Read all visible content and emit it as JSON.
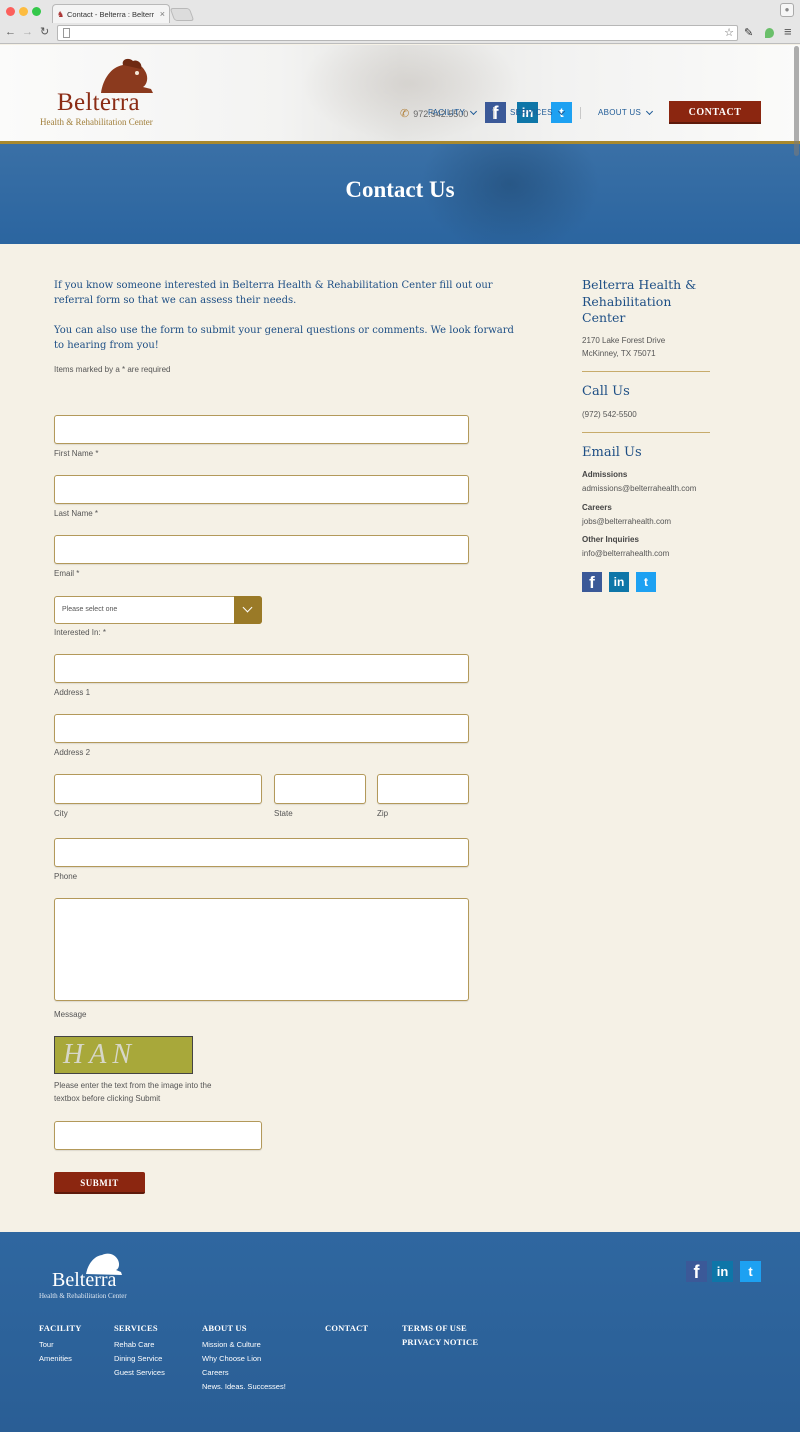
{
  "browser": {
    "tab_title": "Contact - Belterra : Belterr",
    "tab_close": "×",
    "back": "←",
    "forward": "→",
    "reload": "↻",
    "star": "☆",
    "menu": "≡"
  },
  "header": {
    "logo_word": "Belterra",
    "logo_sub": "Health & Rehabilitation Center",
    "phone": "972.542.5500",
    "social": {
      "facebook": "f",
      "linkedin": "in",
      "twitter": "t"
    },
    "nav": [
      {
        "label": "FACILITY"
      },
      {
        "label": "SERVICES"
      },
      {
        "label": "ABOUT US"
      }
    ],
    "contact_label": "CONTACT"
  },
  "hero": {
    "title": "Contact Us"
  },
  "main": {
    "intro1": "If you know someone interested in Belterra Health & Rehabilitation Center fill out our referral form so that we can assess their needs.",
    "intro2": "You can also use the form to submit your general questions or comments. We look forward to hearing from you!",
    "required_note": "Items marked by a * are required",
    "form": {
      "first_name": "First Name *",
      "last_name": "Last Name *",
      "email": "Email *",
      "interested_placeholder": "Please select one",
      "interested": "Interested In: *",
      "address1": "Address 1",
      "address2": "Address 2",
      "city": "City",
      "state": "State",
      "zip": "Zip",
      "phone": "Phone",
      "message": "Message",
      "captcha_text": "HAN",
      "captcha_note": "Please enter the text from the image into the textbox before clicking Submit",
      "submit": "SUBMIT"
    }
  },
  "sidebar": {
    "org_name": "Belterra Health & Rehabilitation Center",
    "address_line1": "2170 Lake Forest Drive",
    "address_line2": "McKinney, TX 75071",
    "call_heading": "Call Us",
    "call_phone": "(972) 542-5500",
    "email_heading": "Email Us",
    "emails": [
      {
        "label": "Admissions",
        "address": "admissions@belterrahealth.com"
      },
      {
        "label": "Careers",
        "address": "jobs@belterrahealth.com"
      },
      {
        "label": "Other Inquiries",
        "address": "info@belterrahealth.com"
      }
    ]
  },
  "footer": {
    "logo_word": "Belterra",
    "logo_sub": "Health & Rehabilitation Center",
    "columns": [
      {
        "heading": "FACILITY",
        "links": [
          "Tour",
          "Amenities"
        ]
      },
      {
        "heading": "SERVICES",
        "links": [
          "Rehab Care",
          "Dining Service",
          "Guest Services"
        ]
      },
      {
        "heading": "ABOUT US",
        "links": [
          "Mission & Culture",
          "Why Choose Lion",
          "Careers",
          "News. Ideas. Successes!"
        ]
      },
      {
        "heading": "CONTACT",
        "links": []
      },
      {
        "heading": "TERMS OF USE",
        "links": [
          "PRIVACY NOTICE"
        ]
      }
    ]
  },
  "colors": {
    "brand_red": "#8b2610",
    "brand_gold": "#9a7a27",
    "brand_blue": "#2b65a0",
    "text_blue": "#1e4f85"
  }
}
